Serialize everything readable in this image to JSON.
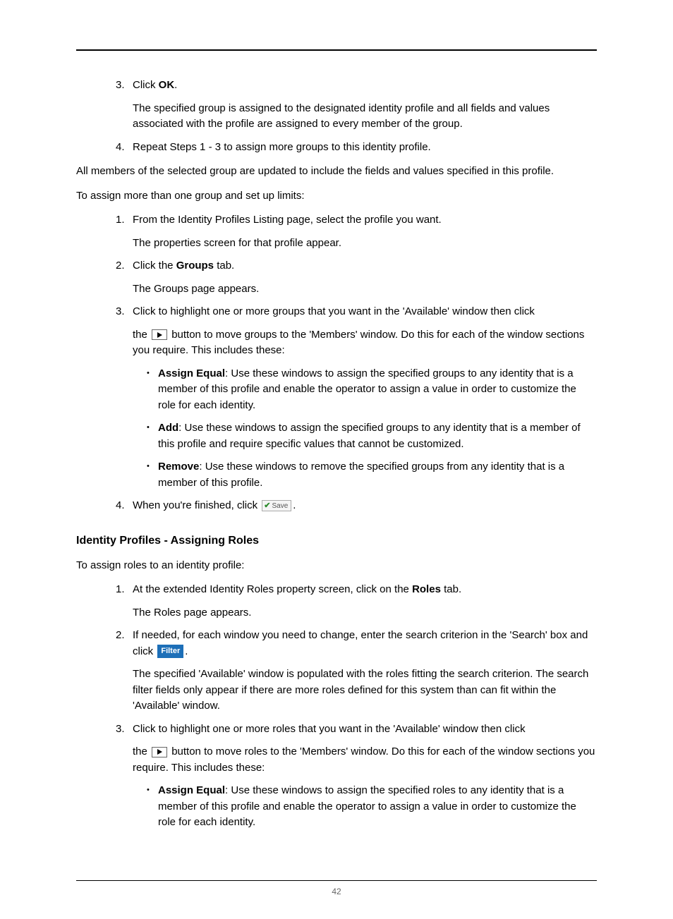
{
  "pageNumber": "42",
  "topList": {
    "item3": {
      "num": "3.",
      "text_pre": "Click ",
      "bold": "OK",
      "text_post": ".",
      "sub": "The specified group is assigned to the designated identity profile and all fields and values associated with the profile are assigned to every member of the group."
    },
    "item4": {
      "num": "4.",
      "text": "Repeat Steps 1 - 3 to assign more groups to this identity profile."
    }
  },
  "para1": "All members of the selected group are updated to include the fields and values specified in this profile.",
  "para2": "To assign more than one group and set up limits:",
  "list2": {
    "item1": {
      "num": "1.",
      "text": "From the Identity Profiles Listing page, select the profile you want.",
      "sub": "The properties screen for that profile appear."
    },
    "item2": {
      "num": "2.",
      "pre": "Click the ",
      "bold": "Groups",
      "post": " tab.",
      "sub": "The Groups page appears."
    },
    "item3": {
      "num": "3.",
      "line1": "Click to highlight one or more groups that you want in the 'Available' window then click",
      "line2_pre": "the ",
      "line2_post": " button to move groups to the 'Members' window. Do this for each of the window sections you require. This includes these:",
      "bullets": {
        "b1_bold": "Assign Equal",
        "b1_text": ": Use these windows to assign the specified groups to any identity that is a member of this profile and enable the operator to assign a value in order to customize the role for each identity.",
        "b2_bold": "Add",
        "b2_text": ": Use these windows to assign the specified groups to any identity that is a member of this profile and require specific values that cannot be customized.",
        "b3_bold": "Remove",
        "b3_text": ": Use these windows to remove the specified groups from any identity that is a member of this profile."
      }
    },
    "item4": {
      "num": "4.",
      "pre": "When you're finished, click ",
      "save_label": "Save",
      "post": "."
    }
  },
  "section_heading": "Identity Profiles - Assigning Roles",
  "para3": "To assign roles to an identity profile:",
  "list3": {
    "item1": {
      "num": "1.",
      "pre": "At the extended Identity Roles property screen, click on the ",
      "bold": "Roles",
      "post": " tab.",
      "sub": "The Roles page appears."
    },
    "item2": {
      "num": "2.",
      "line1_pre": "If needed, for each window you need to change, enter the search criterion in the 'Search' box and click ",
      "filter_label": "Filter",
      "line1_post": ".",
      "sub": "The specified 'Available' window is populated with the roles fitting the search criterion. The search filter fields only appear if there are more roles defined for this system than can fit within the 'Available' window."
    },
    "item3": {
      "num": "3.",
      "line1": "Click to highlight one or more roles that you want in the 'Available' window then click",
      "line2_pre": "the ",
      "line2_post": " button to move roles to the 'Members' window. Do this for each of the window sections you require. This includes these:",
      "bullets": {
        "b1_bold": "Assign Equal",
        "b1_text": ": Use these windows to assign the specified roles to any identity that is a member of this profile and enable the operator to assign a value in order to customize the role for each identity."
      }
    }
  }
}
